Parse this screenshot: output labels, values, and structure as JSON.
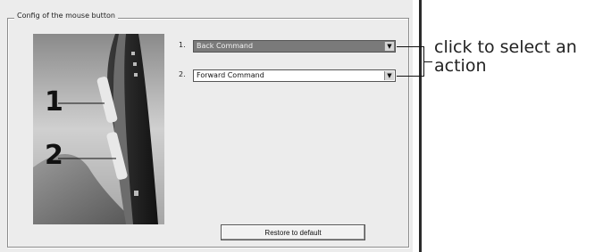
{
  "groupbox": {
    "title": "Config of the mouse button"
  },
  "mouse": {
    "button1_label": "1",
    "button2_label": "2"
  },
  "selects": [
    {
      "number": "1.",
      "value": "Back Command"
    },
    {
      "number": "2.",
      "value": "Forward Command"
    }
  ],
  "restore_button": {
    "label": "Restore to default"
  },
  "annotation": {
    "text": "click to select an action"
  }
}
